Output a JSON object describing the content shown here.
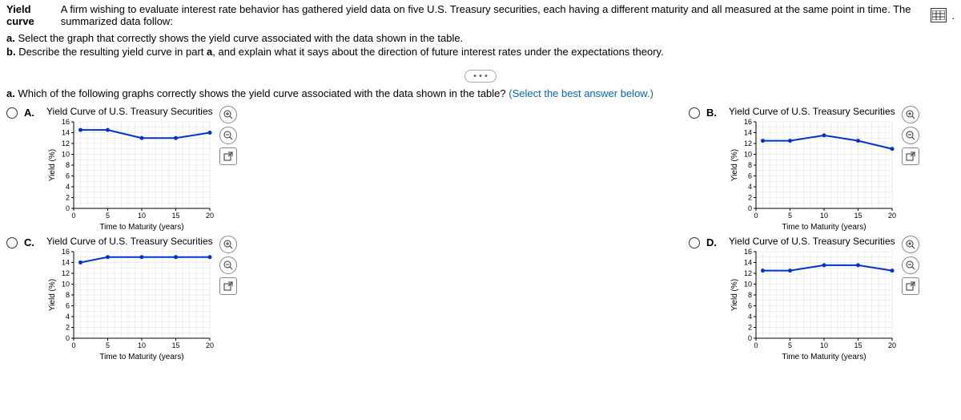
{
  "header": {
    "title_bold": "Yield curve",
    "title_rest": "A firm wishing to evaluate interest rate behavior has gathered yield data on five U.S. Treasury securities, each having a different maturity and all measured at the same point in time.  The summarized data follow:"
  },
  "instructions": {
    "a_bold": "a.",
    "a_text": "Select the graph that correctly shows the yield curve associated with the data shown in the table.",
    "b_bold": "b.",
    "b_text_1": "Describe the resulting yield curve in part ",
    "b_ref": "a",
    "b_text_2": ", and explain what it says about the direction of future interest rates under the expectations theory."
  },
  "ellipsis": "• • •",
  "prompt": {
    "a_bold": "a.",
    "text": "Which of the following graphs correctly shows the yield curve associated with the data shown in the table?",
    "hint": "(Select the best answer below.)"
  },
  "choices": {
    "A": "A.",
    "B": "B.",
    "C": "C.",
    "D": "D."
  },
  "chart_common": {
    "title": "Yield Curve of U.S. Treasury Securities",
    "xlabel": "Time to Maturity (years)",
    "ylabel": "Yield (%)",
    "x_ticks": [
      0,
      5,
      10,
      15,
      20
    ],
    "y_ticks": [
      0,
      2,
      4,
      6,
      8,
      10,
      12,
      14,
      16
    ],
    "xlim": [
      0,
      20
    ],
    "ylim": [
      0,
      16
    ]
  },
  "chart_data": [
    {
      "id": "A",
      "type": "line",
      "x": [
        1,
        5,
        10,
        15,
        20
      ],
      "y": [
        14.5,
        14.5,
        13.0,
        13.0,
        14.0
      ]
    },
    {
      "id": "B",
      "type": "line",
      "x": [
        1,
        5,
        10,
        15,
        20
      ],
      "y": [
        12.5,
        12.5,
        13.5,
        12.5,
        11.0
      ]
    },
    {
      "id": "C",
      "type": "line",
      "x": [
        1,
        5,
        10,
        15,
        20
      ],
      "y": [
        14.0,
        15.0,
        15.0,
        15.0,
        15.0
      ]
    },
    {
      "id": "D",
      "type": "line",
      "x": [
        1,
        5,
        10,
        15,
        20
      ],
      "y": [
        12.5,
        12.5,
        13.5,
        13.5,
        12.5
      ]
    }
  ],
  "tools": {
    "zoom_in": "⊕",
    "zoom_out": "⊖",
    "popout": "⇱"
  }
}
